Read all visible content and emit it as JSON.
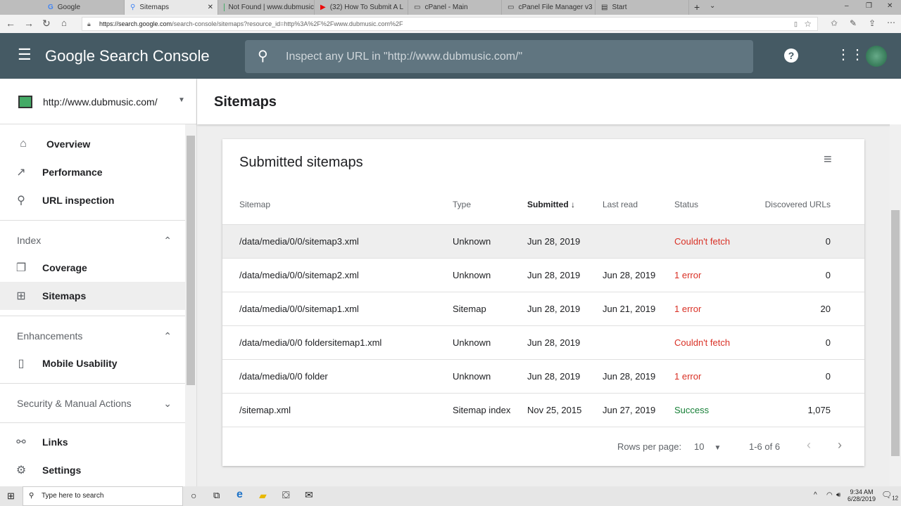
{
  "browser": {
    "tabs": [
      {
        "label": "Google"
      },
      {
        "label": "Sitemaps",
        "active": true
      },
      {
        "label": "Not Found | www.dubmusic"
      },
      {
        "label": "(32) How To Submit A L"
      },
      {
        "label": "cPanel - Main"
      },
      {
        "label": "cPanel File Manager v3"
      },
      {
        "label": "Start"
      }
    ],
    "url_host": "https://search.google.com",
    "url_path": "/search-console/sitemaps?resource_id=http%3A%2F%2Fwww.dubmusic.com%2F"
  },
  "header": {
    "title": "Google Search Console",
    "search_placeholder": "Inspect any URL in \"http://www.dubmusic.com/\""
  },
  "sidebar": {
    "property": "http://www.dubmusic.com/",
    "items": [
      {
        "label": "Overview",
        "icon": "home-icon"
      },
      {
        "label": "Performance",
        "icon": "trending-icon"
      },
      {
        "label": "URL inspection",
        "icon": "search-icon"
      }
    ],
    "index_label": "Index",
    "index_items": [
      {
        "label": "Coverage"
      },
      {
        "label": "Sitemaps"
      }
    ],
    "enh_label": "Enhancements",
    "enh_items": [
      {
        "label": "Mobile Usability"
      }
    ],
    "security_label": "Security & Manual Actions",
    "bottom_items": [
      {
        "label": "Links"
      },
      {
        "label": "Settings"
      }
    ]
  },
  "page": {
    "title": "Sitemaps"
  },
  "card": {
    "title": "Submitted sitemaps",
    "columns": [
      "Sitemap",
      "Type",
      "Submitted",
      "Last read",
      "Status",
      "Discovered URLs"
    ],
    "rows": [
      [
        "/data/media/0/0/sitemap3.xml",
        "Unknown",
        "Jun 28, 2019",
        "",
        "Couldn't fetch",
        "0"
      ],
      [
        "/data/media/0/0/sitemap2.xml",
        "Unknown",
        "Jun 28, 2019",
        "Jun 28, 2019",
        "1 error",
        "0"
      ],
      [
        "/data/media/0/0/sitemap1.xml",
        "Sitemap",
        "Jun 28, 2019",
        "Jun 21, 2019",
        "1 error",
        "20"
      ],
      [
        "/data/media/0/0 foldersitemap1.xml",
        "Unknown",
        "Jun 28, 2019",
        "",
        "Couldn't fetch",
        "0"
      ],
      [
        "/data/media/0/0 folder",
        "Unknown",
        "Jun 28, 2019",
        "Jun 28, 2019",
        "1 error",
        "0"
      ],
      [
        "/sitemap.xml",
        "Sitemap index",
        "Nov 25, 2015",
        "Jun 27, 2019",
        "Success",
        "1,075"
      ]
    ],
    "rows_per_page_label": "Rows per page:",
    "rows_per_page": "10",
    "range": "1-6 of 6"
  },
  "taskbar": {
    "search_placeholder": "Type here to search",
    "time": "9:34 AM",
    "date": "6/28/2019",
    "notifications": "12"
  }
}
